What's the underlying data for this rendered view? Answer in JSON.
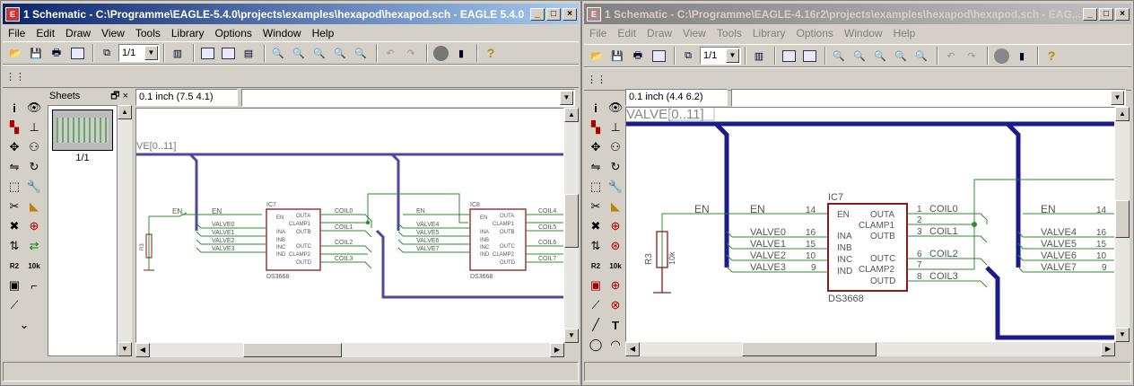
{
  "left_window": {
    "title": "1 Schematic - C:\\Programme\\EAGLE-5.4.0\\projects\\examples\\hexapod\\hexapod.sch - EAGLE 5.4.0",
    "menu": [
      "File",
      "Edit",
      "Draw",
      "View",
      "Tools",
      "Library",
      "Options",
      "Window",
      "Help"
    ],
    "sheet_combo": "1/1",
    "grid_readout": "0.1 inch (7.5 4.1)",
    "command_input": "",
    "sheets_title": "Sheets",
    "sheet_label": "1/1"
  },
  "right_window": {
    "title": "1 Schematic - C:\\Programme\\EAGLE-4.16r2\\projects\\examples\\hexapod\\hexapod.sch - EAG...",
    "menu": [
      "File",
      "Edit",
      "Draw",
      "View",
      "Tools",
      "Library",
      "Options",
      "Window",
      "Help"
    ],
    "sheet_combo": "1/1",
    "grid_readout": "0.1 inch (4.4 6.2)",
    "command_input": ""
  },
  "schematic": {
    "bus_label": "VALVE[0..11]",
    "bus_label_partial_left": "VE[0..11]",
    "bus_label_partial_right": "VALVE[0..11]",
    "ic7": {
      "name": "IC7",
      "value": "DS3668"
    },
    "ic8": {
      "name": "IC8",
      "value": "DS3668"
    },
    "resistor": {
      "name": "R3",
      "value": "10k"
    },
    "pins_left": [
      "EN",
      "INA",
      "INB",
      "INC",
      "IND"
    ],
    "pins_right": [
      "OUTA",
      "CLAMP1",
      "OUTB",
      "OUTC",
      "CLAMP2",
      "OUTD"
    ],
    "pin_numbers_left": [
      "14",
      "16",
      "15",
      "10",
      "9"
    ],
    "pin_numbers_right": [
      "1",
      "2",
      "3",
      "6",
      "7",
      "8"
    ],
    "nets_ic7_in": [
      "EN",
      "VALVE0",
      "VALVE1",
      "VALVE2",
      "VALVE3"
    ],
    "nets_ic8_in": [
      "EN",
      "VALVE4",
      "VALVE5",
      "VALVE6",
      "VALVE7"
    ],
    "nets_ic7_out": [
      "COIL0",
      "COIL1",
      "COIL2",
      "COIL3"
    ],
    "nets_ic8_out": [
      "COIL4",
      "COIL5",
      "COIL6",
      "COIL7"
    ],
    "en_net": "EN"
  },
  "colors": {
    "wire": "#2e8b2e",
    "bus": "#1a1a8c",
    "part": "#8b1a1a",
    "text": "#555555"
  }
}
